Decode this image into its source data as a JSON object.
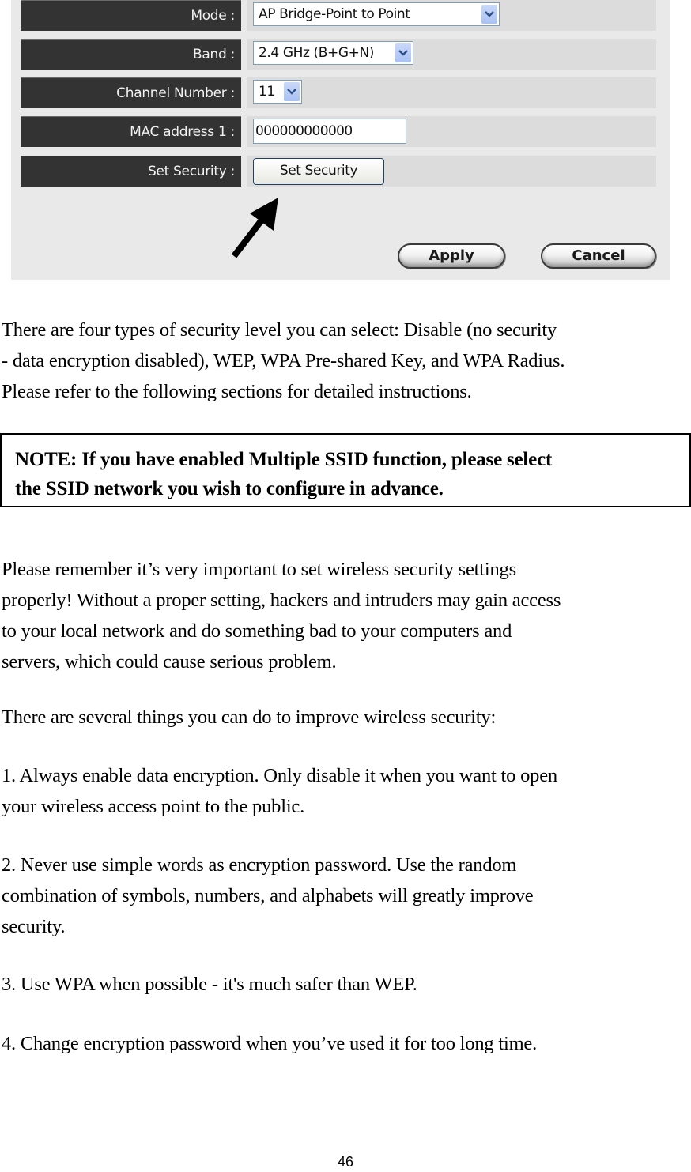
{
  "screenshot": {
    "fields": [
      {
        "label": "Mode :",
        "type": "select",
        "value": "AP Bridge-Point to Point"
      },
      {
        "label": "Band :",
        "type": "select",
        "value": "2.4 GHz (B+G+N)"
      },
      {
        "label": "Channel Number :",
        "type": "select",
        "value": "11"
      },
      {
        "label": "MAC address 1 :",
        "type": "text",
        "value": "000000000000"
      },
      {
        "label": "Set Security :",
        "type": "button",
        "value": "Set Security"
      }
    ],
    "apply_label": "Apply",
    "cancel_label": "Cancel",
    "colors": {
      "label_background": "#333333",
      "field_background": "#dcdcdc",
      "panel_background": "#e9e9e9"
    }
  },
  "document": {
    "intro_lines": [
      "There are four types of security level you can select: Disable (no security",
      "- data encryption disabled), WEP, WPA Pre-shared Key, and WPA Radius.",
      "Please refer to the following sections for detailed instructions."
    ],
    "note_lines": [
      "NOTE: If you have enabled Multiple SSID function, please select",
      "the SSID network you wish to configure in advance."
    ],
    "reminder_lines": [
      "Please remember it’s very important to set wireless security settings",
      "properly! Without a proper setting, hackers and intruders may gain access",
      "to your local network and do something bad to your computers and",
      "servers, which could cause serious problem."
    ],
    "tips_intro": "There are several things you can do to improve wireless security:",
    "tips": [
      [
        "1. Always enable data encryption. Only disable it when you want to open",
        "your wireless access point to the public."
      ],
      [
        "2. Never use simple words as encryption password. Use the random",
        "combination of symbols, numbers, and alphabets will greatly improve",
        "security."
      ],
      [
        "3. Use WPA when possible - it's much safer than WEP."
      ],
      [
        "4. Change encryption password when you’ve used it for too long time."
      ]
    ]
  },
  "page_number": "46"
}
